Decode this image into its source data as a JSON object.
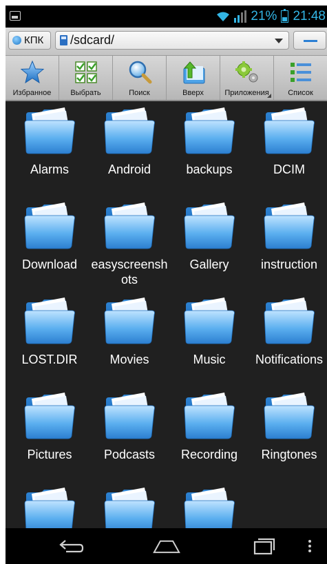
{
  "status_bar": {
    "battery_percent": "21%",
    "time": "21:48",
    "accent_color": "#33b5e5"
  },
  "path_bar": {
    "location_button": "КПК",
    "current_path": "/sdcard/"
  },
  "toolbar": {
    "buttons": [
      {
        "label": "Избранное",
        "icon": "star-icon"
      },
      {
        "label": "Выбрать",
        "icon": "select-grid-icon"
      },
      {
        "label": "Поиск",
        "icon": "search-icon"
      },
      {
        "label": "Вверх",
        "icon": "folder-up-icon"
      },
      {
        "label": "Приложения",
        "icon": "gears-icon"
      },
      {
        "label": "Список",
        "icon": "list-view-icon"
      }
    ]
  },
  "files": [
    "Alarms",
    "Android",
    "backups",
    "DCIM",
    "Download",
    "easyscreenshots",
    "Gallery",
    "instruction",
    "LOST.DIR",
    "Movies",
    "Music",
    "Notifications",
    "Pictures",
    "Podcasts",
    "Recording",
    "Ringtones",
    "",
    "",
    ""
  ],
  "nav_bar": {
    "buttons": [
      "back-icon",
      "home-icon",
      "recent-apps-icon",
      "menu-icon"
    ]
  }
}
